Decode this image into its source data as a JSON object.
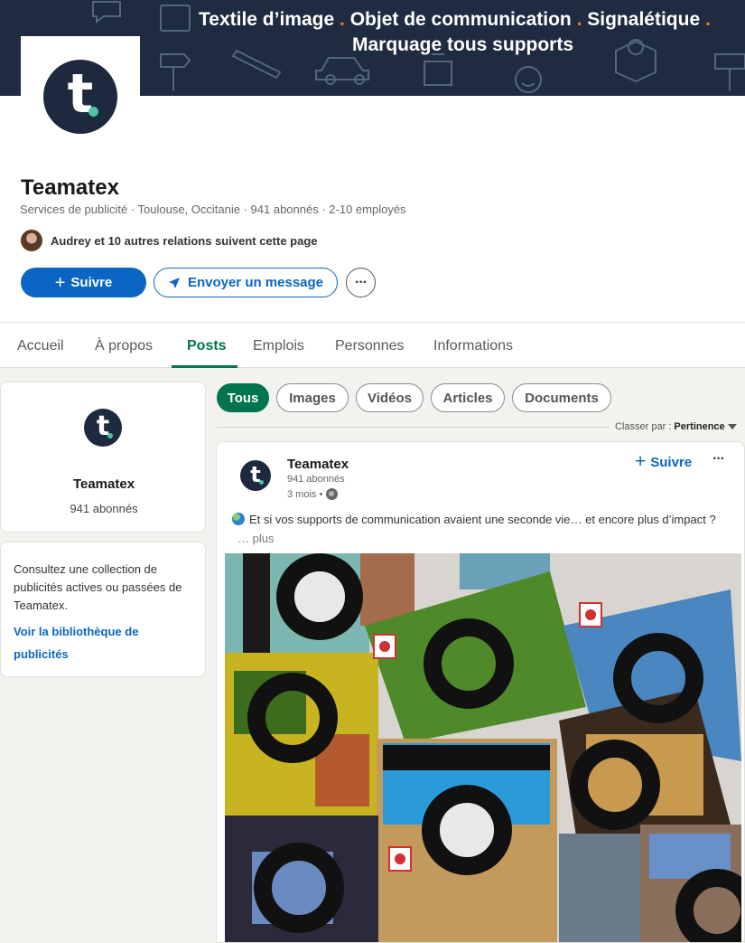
{
  "banner": {
    "line1_part1": "Textile d’image",
    "line1_part2": "Objet de communication",
    "line1_part3": "Signalétique",
    "line2": "Marquage tous supports",
    "separator": ".",
    "accent_color": "#f07f2a",
    "background_color": "#1f2b40"
  },
  "company": {
    "logo_letter": "t",
    "logo_dot": ".",
    "name": "Teamatex",
    "meta": "Services de publicité · Toulouse, Occitanie · 941 abonnés · 2-10 employés",
    "followers_text": "Audrey et 10 autres relations suivent cette page"
  },
  "actions": {
    "follow_icon": "+",
    "follow_label": "Suivre",
    "message_label": "Envoyer un message",
    "more_label": "···",
    "primary_color": "#0a66c2"
  },
  "tabs": [
    {
      "label": "Accueil"
    },
    {
      "label": "À propos"
    },
    {
      "label": "Posts",
      "active": true
    },
    {
      "label": "Emplois"
    },
    {
      "label": "Personnes"
    },
    {
      "label": "Informations"
    }
  ],
  "sidebar": {
    "card1": {
      "name": "Teamatex",
      "followers": "941 abonnés"
    },
    "card2": {
      "text": "Consultez une collection de publicités actives ou passées de Teamatex.",
      "link": "Voir la bibliothèque de publicités"
    }
  },
  "filters": [
    {
      "label": "Tous",
      "active": true
    },
    {
      "label": "Images"
    },
    {
      "label": "Vidéos"
    },
    {
      "label": "Articles"
    },
    {
      "label": "Documents"
    }
  ],
  "sort": {
    "label": "Classer par :",
    "value": "Pertinence"
  },
  "post": {
    "author": "Teamatex",
    "followers": "941 abonnés",
    "time": "3 mois •",
    "follow_label": "Suivre",
    "more_label": "···",
    "text": "Et si vos supports de communication avaient une seconde vie… et encore plus d’impact ?",
    "more_link": "… plus"
  }
}
